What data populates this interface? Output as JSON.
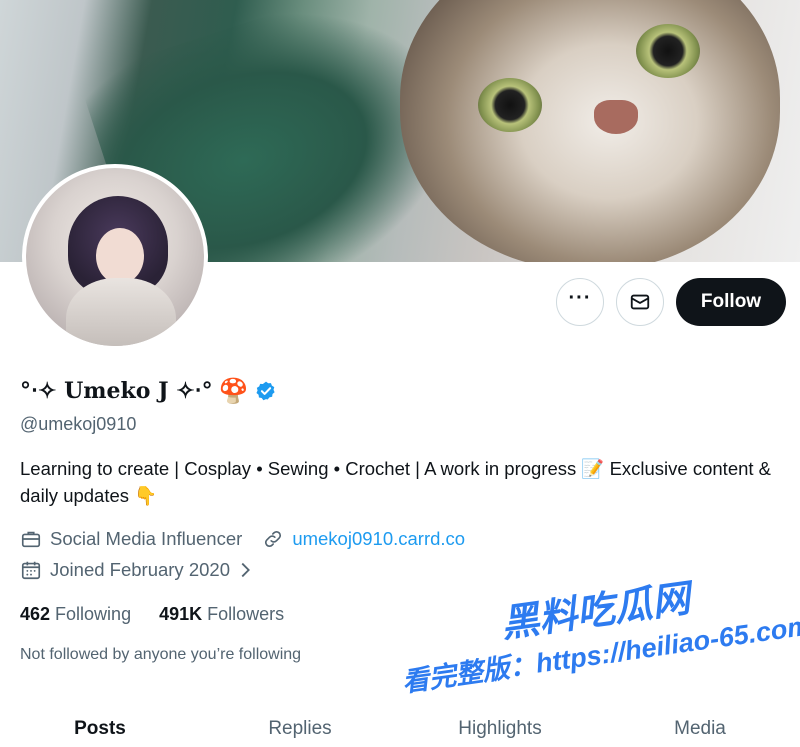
{
  "profile": {
    "display_name": "°‧✧ Umeko J ✧‧°",
    "name_emoji": "🍄",
    "handle": "@umekoj0910",
    "bio": "Learning to create | Cosplay • Sewing • Crochet | A work in progress 📝 Exclusive content & daily updates 👇",
    "category": "Social Media Influencer",
    "website": "umekoj0910.carrd.co",
    "joined": "Joined February 2020",
    "following_count": "462",
    "following_label": "Following",
    "followers_count": "491K",
    "followers_label": "Followers",
    "not_followed_text": "Not followed by anyone you’re following"
  },
  "actions": {
    "more_label": "···",
    "follow_label": "Follow"
  },
  "tabs": [
    {
      "label": "Posts"
    },
    {
      "label": "Replies"
    },
    {
      "label": "Highlights"
    },
    {
      "label": "Media"
    }
  ],
  "watermark": {
    "title": "黑料吃瓜网",
    "url": "看完整版：https://heiliao-65.com"
  },
  "icons": {
    "verified": "verified-badge-icon",
    "briefcase": "briefcase-icon",
    "link": "link-icon",
    "calendar": "calendar-icon",
    "mail": "mail-icon",
    "chevron": "chevron-right-icon"
  },
  "colors": {
    "accent": "#1d9bf0",
    "primary_text": "#0f1419",
    "secondary_text": "#536471",
    "follow_bg": "#0f1419",
    "watermark": "#2d7bf0"
  }
}
